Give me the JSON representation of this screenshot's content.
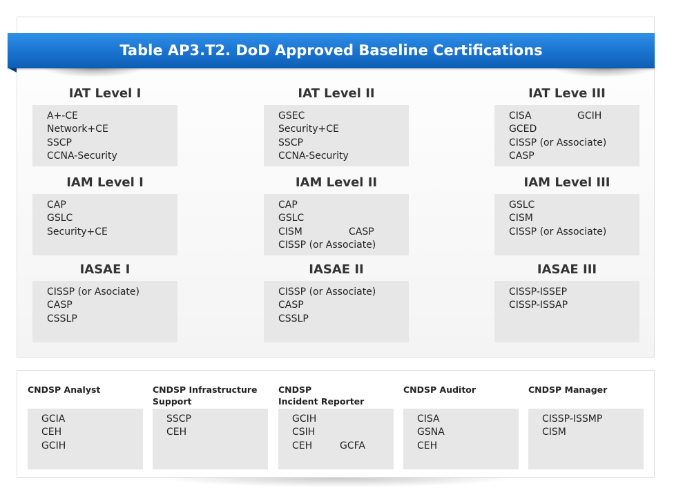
{
  "title": "Table AP3.T2. DoD Approved Baseline Certifications",
  "groups": [
    {
      "title": "IAT Level I",
      "items": [
        "A+-CE",
        "Network+CE",
        "SSCP",
        "CCNA-Security"
      ]
    },
    {
      "title": "IAT Level II",
      "items": [
        "GSEC",
        "Security+CE",
        "SSCP",
        "CCNA-Security"
      ]
    },
    {
      "title": "IAT Leve III",
      "items": [
        "CISA",
        "GCED",
        "CISSP (or Associate)",
        "CASP"
      ],
      "side": "GCIH"
    },
    {
      "title": "IAM Level I",
      "items": [
        "CAP",
        "GSLC",
        "Security+CE"
      ]
    },
    {
      "title": "IAM Level II",
      "items": [
        "CAP",
        "GSLC",
        "CISM",
        "CISSP (or Associate)"
      ],
      "side": "CASP"
    },
    {
      "title": "IAM Level III",
      "items": [
        "GSLC",
        "CISM",
        "CISSP (or Associate)"
      ]
    },
    {
      "title": "IASAE I",
      "items": [
        "CISSP (or Asociate)",
        "CASP",
        "CSSLP"
      ]
    },
    {
      "title": "IASAE II",
      "items": [
        "CISSP (or Associate)",
        "CASP",
        "CSSLP"
      ]
    },
    {
      "title": "IASAE III",
      "items": [
        "CISSP-ISSEP",
        "CISSP-ISSAP"
      ]
    }
  ],
  "cndsp": [
    {
      "title_lines": [
        "CNDSP Analyst"
      ],
      "items": [
        "GCIA",
        "CEH",
        "GCIH"
      ]
    },
    {
      "title_lines": [
        "CNDSP Infrastructure",
        "Support"
      ],
      "items": [
        "SSCP",
        "CEH"
      ]
    },
    {
      "title_lines": [
        "CNDSP",
        "Incident Reporter"
      ],
      "items": [
        "GCIH",
        "CSIH",
        "CEH"
      ],
      "side": "GCFA"
    },
    {
      "title_lines": [
        "CNDSP Auditor"
      ],
      "items": [
        "CISA",
        "GSNA",
        "CEH"
      ]
    },
    {
      "title_lines": [
        "CNDSP Manager"
      ],
      "items": [
        "CISSP-ISSMP",
        "CISM"
      ]
    }
  ]
}
